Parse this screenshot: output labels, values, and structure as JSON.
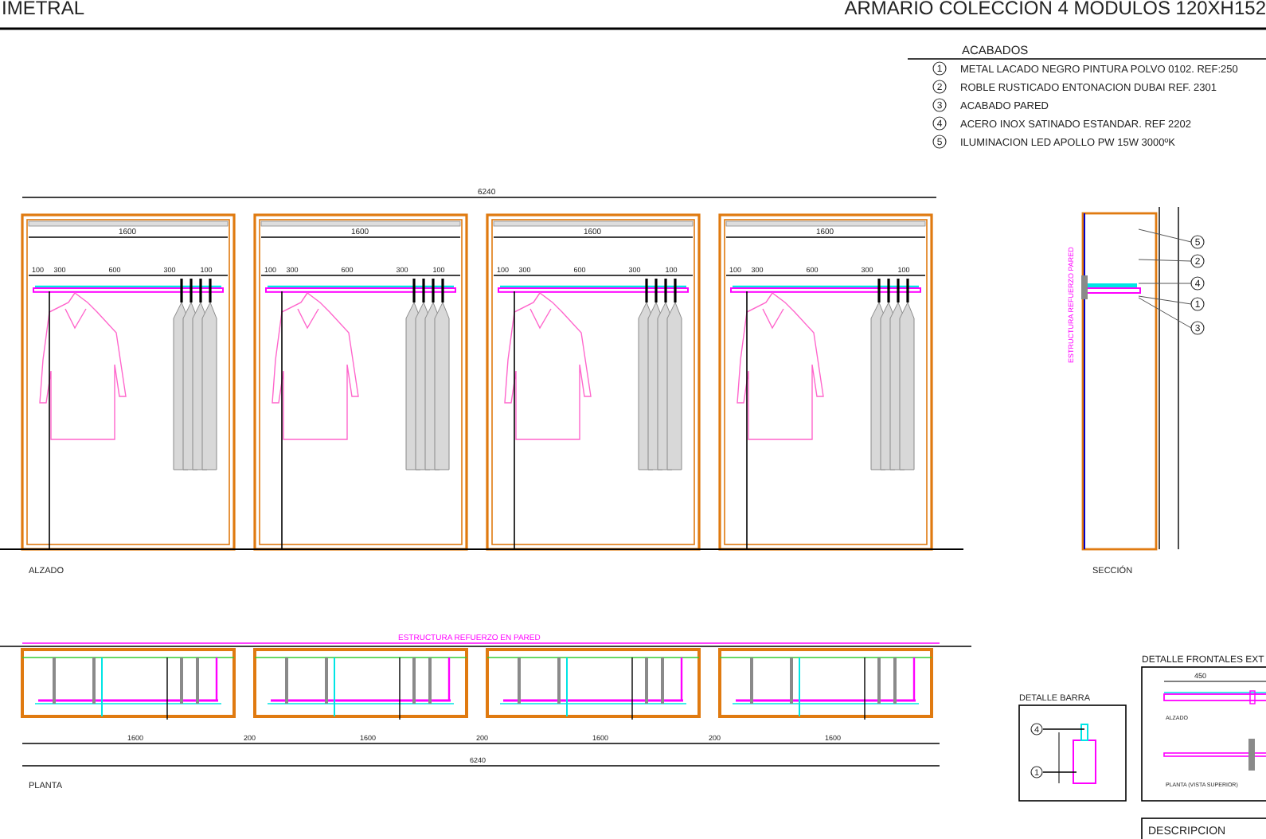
{
  "header": {
    "left_title": "IMETRAL",
    "right_title": "ARMARIO COLECCION 4 MODULOS 120XH152"
  },
  "finishes": {
    "title": "ACABADOS",
    "items": [
      {
        "number": "1",
        "label": "METAL LACADO NEGRO PINTURA POLVO 0102. REF:250"
      },
      {
        "number": "2",
        "label": "ROBLE RUSTICADO ENTONACION DUBAI REF. 2301"
      },
      {
        "number": "3",
        "label": "ACABADO PARED"
      },
      {
        "number": "4",
        "label": "ACERO INOX SATINADO ESTANDAR. REF 2202"
      },
      {
        "number": "5",
        "label": "ILUMINACION LED APOLLO PW 15W 3000ºK"
      }
    ]
  },
  "elevation": {
    "label": "ALZADO",
    "overall_dimension": "6240",
    "modules": [
      {
        "width_dimension": "1600",
        "rail_dimensions": [
          "100",
          "300",
          "600",
          "300",
          "100"
        ]
      },
      {
        "width_dimension": "1600",
        "rail_dimensions": [
          "100",
          "300",
          "600",
          "300",
          "100"
        ]
      },
      {
        "width_dimension": "1600",
        "rail_dimensions": [
          "100",
          "300",
          "600",
          "300",
          "100"
        ]
      },
      {
        "width_dimension": "1600",
        "rail_dimensions": [
          "100",
          "300",
          "600",
          "300",
          "100"
        ]
      }
    ]
  },
  "section": {
    "label": "SECCIÓN",
    "vertical_label": "ESTRUCTURA REFUERZO PARED",
    "callouts": [
      "5",
      "2",
      "4",
      "1",
      "3"
    ]
  },
  "plan": {
    "label": "PLANTA",
    "annotation": "ESTRUCTURA REFUERZO EN PARED",
    "module_dimensions": [
      "1600",
      "200",
      "1600",
      "200",
      "1600",
      "200",
      "1600"
    ],
    "overall_dimension": "6240"
  },
  "bar_detail": {
    "title": "DETALLE BARRA",
    "callouts": [
      "4",
      "1"
    ]
  },
  "front_detail": {
    "title": "DETALLE FRONTALES EXT",
    "top_dimension": "450",
    "caption_top": "ALZADO",
    "caption_bottom": "PLANTA (VISTA SUPERIOR)"
  },
  "description": {
    "title": "DESCRIPCION"
  }
}
